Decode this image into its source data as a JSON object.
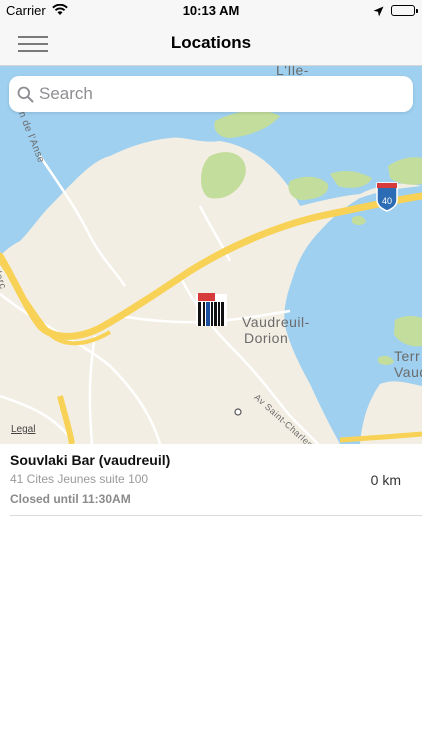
{
  "status_bar": {
    "carrier": "Carrier",
    "time": "10:13 AM"
  },
  "nav": {
    "title": "Locations",
    "menu_icon": "hamburger-menu-icon"
  },
  "search": {
    "placeholder": "Search"
  },
  "map": {
    "labels": {
      "ile": "L'Île-",
      "vaudreuil_1": "Vaudreuil-",
      "vaudreuil_2": "Dorion",
      "terr_1": "Terr",
      "terr_2": "Vaud",
      "anse": "h de l'Anse",
      "clerc": "lerc",
      "saint_charles": "Av Saint-Charles",
      "highway": "40"
    },
    "legal": "Legal",
    "colors": {
      "water": "#9fd0f0",
      "land": "#f3eee3",
      "park": "#c3dd9c",
      "highway": "#f7d256"
    }
  },
  "locations": [
    {
      "name": "Souvlaki Bar (vaudreuil)",
      "address": "41 Cites Jeunes suite 100",
      "status": "Closed until 11:30AM",
      "distance": "0 km"
    }
  ]
}
